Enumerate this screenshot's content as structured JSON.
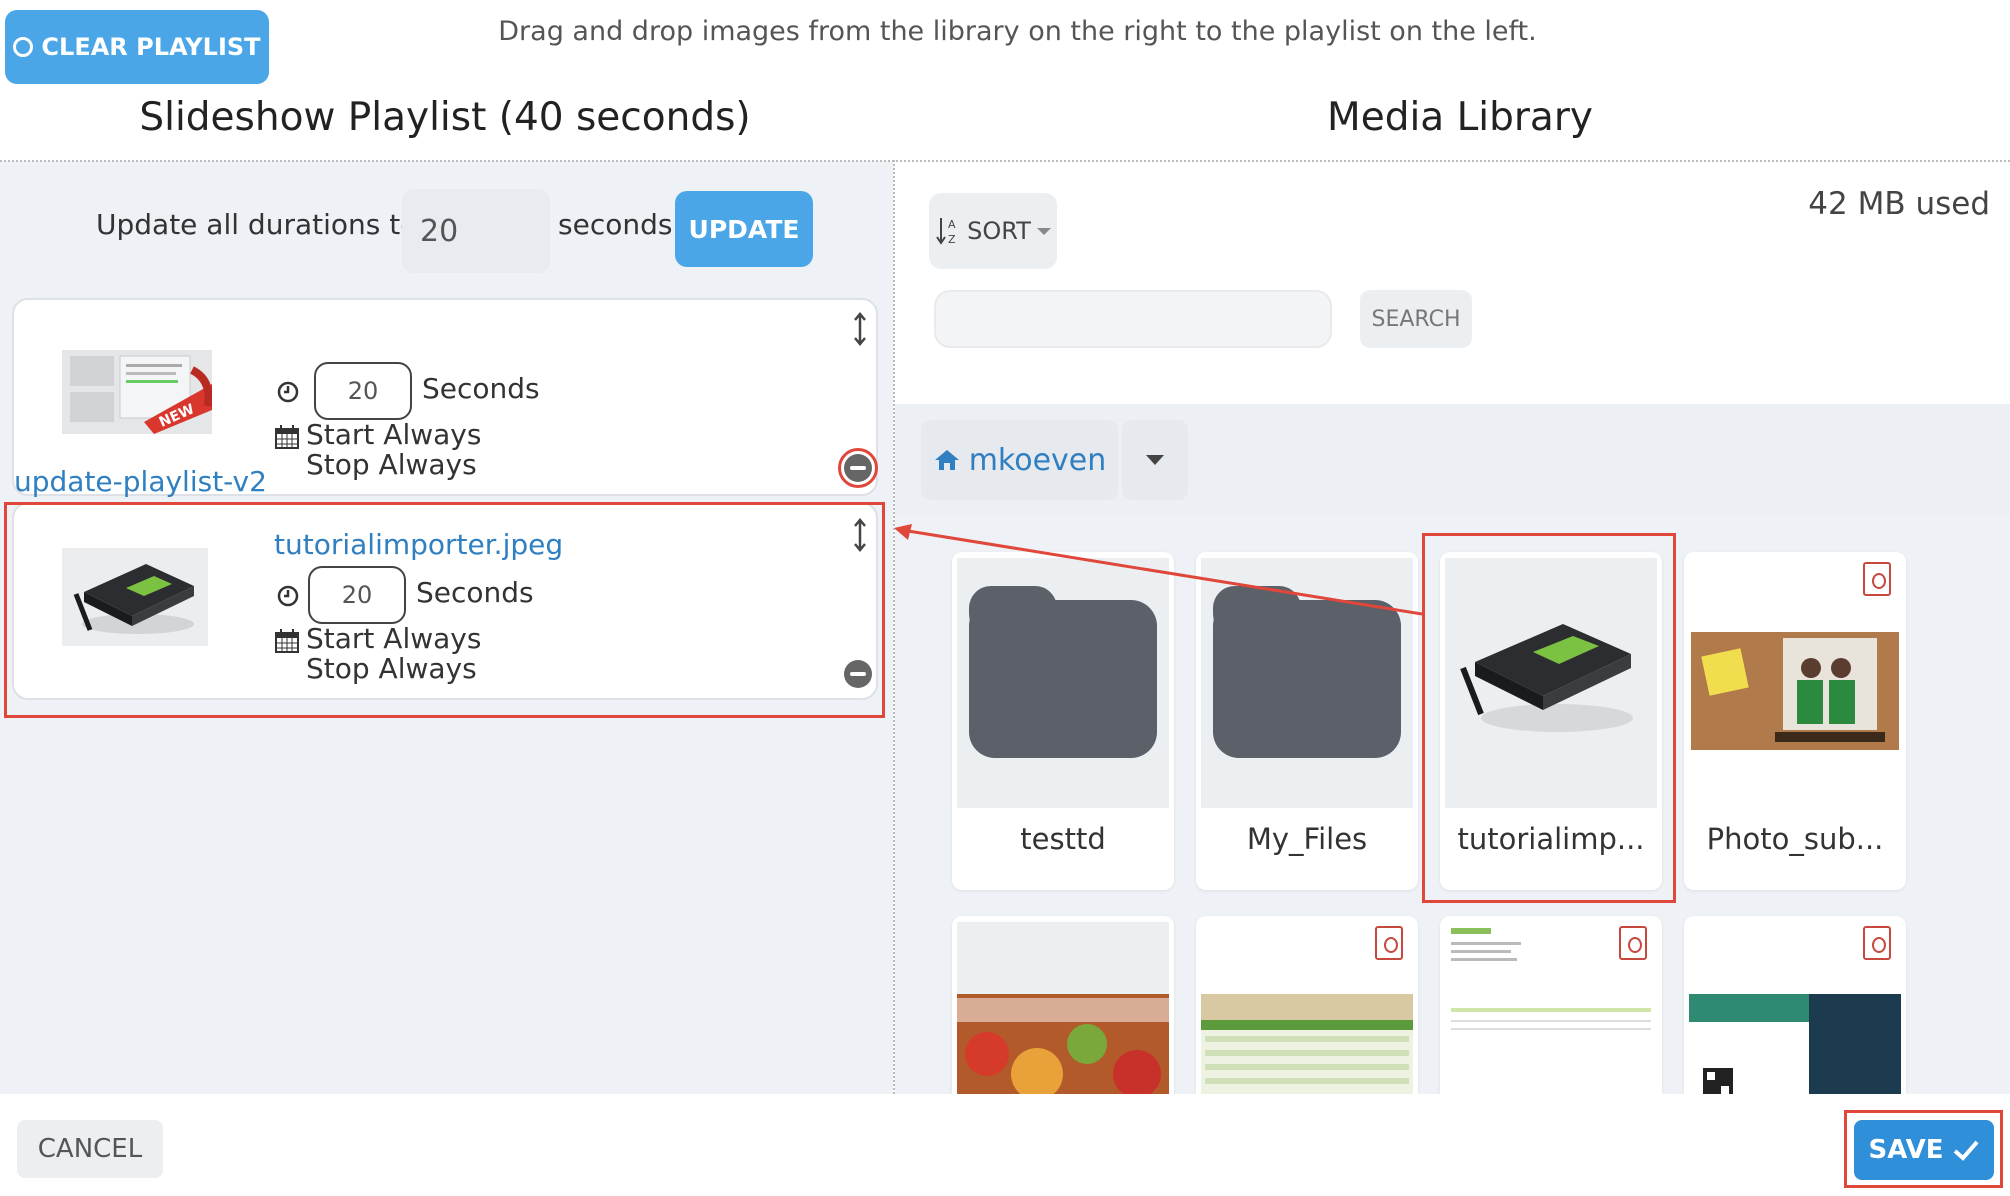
{
  "toolbar": {
    "clear_label": "CLEAR PLAYLIST",
    "instructions": "Drag and drop images from the library on the right to the playlist on the left."
  },
  "playlist": {
    "title": "Slideshow Playlist (40 seconds)",
    "update_all_label": "Update all durations to",
    "update_all_value": "20",
    "seconds_label": "seconds",
    "update_button": "UPDATE",
    "items": [
      {
        "name": "update-playlist-v2",
        "duration": "20",
        "seconds_label": "Seconds",
        "start": "Start Always",
        "stop": "Stop Always",
        "badge": "NEW"
      },
      {
        "name": "tutorialimporter.jpeg",
        "duration": "20",
        "seconds_label": "Seconds",
        "start": "Start Always",
        "stop": "Stop Always"
      }
    ]
  },
  "library": {
    "title": "Media Library",
    "usage": "42 MB used",
    "sort_label": "SORT",
    "search_value": "",
    "search_button": "SEARCH",
    "folder": "mkoeven",
    "tiles": [
      {
        "name": "testtd",
        "type": "folder"
      },
      {
        "name": "My_Files",
        "type": "folder"
      },
      {
        "name": "tutorialimp...",
        "type": "image"
      },
      {
        "name": "Photo_sub...",
        "type": "pdf"
      }
    ]
  },
  "footer": {
    "cancel_label": "CANCEL",
    "save_label": "SAVE"
  },
  "colors": {
    "accent": "#4aa6e6",
    "link": "#2f7fc1",
    "highlight": "#e0473b"
  }
}
